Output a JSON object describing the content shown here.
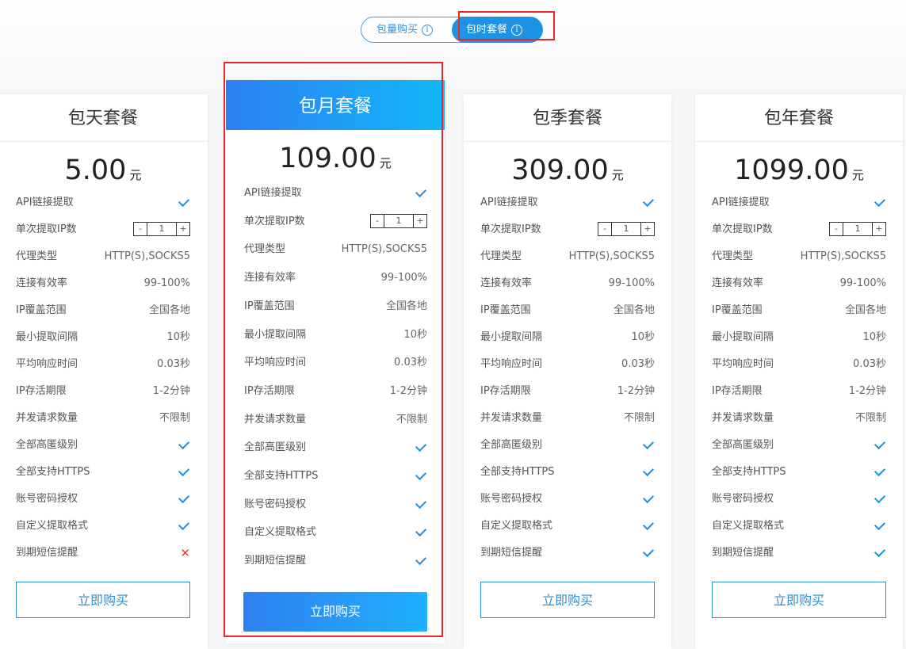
{
  "toggle": {
    "left_label": "包量购买",
    "right_label": "包时套餐",
    "info_glyph": "i"
  },
  "plans": [
    {
      "name": "包天套餐",
      "price": "5.00",
      "unit": "元",
      "features": [
        {
          "label": "API链接提取",
          "type": "check"
        },
        {
          "label": "单次提取IP数",
          "type": "stepper",
          "value": "1"
        },
        {
          "label": "代理类型",
          "type": "text",
          "value": "HTTP(S),SOCKS5"
        },
        {
          "label": "连接有效率",
          "type": "text",
          "value": "99-100%"
        },
        {
          "label": "IP覆盖范围",
          "type": "text",
          "value": "全国各地"
        },
        {
          "label": "最小提取间隔",
          "type": "text",
          "value": "10秒"
        },
        {
          "label": "平均响应时间",
          "type": "text",
          "value": "0.03秒"
        },
        {
          "label": "IP存活期限",
          "type": "text",
          "value": "1-2分钟"
        },
        {
          "label": "并发请求数量",
          "type": "text",
          "value": "不限制"
        },
        {
          "label": "全部高匿级别",
          "type": "check"
        },
        {
          "label": "全部支持HTTPS",
          "type": "check"
        },
        {
          "label": "账号密码授权",
          "type": "check"
        },
        {
          "label": "自定义提取格式",
          "type": "check"
        },
        {
          "label": "到期短信提醒",
          "type": "cross"
        }
      ],
      "button": "立即购买"
    },
    {
      "name": "包月套餐",
      "price": "109.00",
      "unit": "元",
      "features": [
        {
          "label": "API链接提取",
          "type": "check"
        },
        {
          "label": "单次提取IP数",
          "type": "stepper",
          "value": "1"
        },
        {
          "label": "代理类型",
          "type": "text",
          "value": "HTTP(S),SOCKS5"
        },
        {
          "label": "连接有效率",
          "type": "text",
          "value": "99-100%"
        },
        {
          "label": "IP覆盖范围",
          "type": "text",
          "value": "全国各地"
        },
        {
          "label": "最小提取间隔",
          "type": "text",
          "value": "10秒"
        },
        {
          "label": "平均响应时间",
          "type": "text",
          "value": "0.03秒"
        },
        {
          "label": "IP存活期限",
          "type": "text",
          "value": "1-2分钟"
        },
        {
          "label": "并发请求数量",
          "type": "text",
          "value": "不限制"
        },
        {
          "label": "全部高匿级别",
          "type": "check"
        },
        {
          "label": "全部支持HTTPS",
          "type": "check"
        },
        {
          "label": "账号密码授权",
          "type": "check"
        },
        {
          "label": "自定义提取格式",
          "type": "check"
        },
        {
          "label": "到期短信提醒",
          "type": "check"
        }
      ],
      "button": "立即购买"
    },
    {
      "name": "包季套餐",
      "price": "309.00",
      "unit": "元",
      "features": [
        {
          "label": "API链接提取",
          "type": "check"
        },
        {
          "label": "单次提取IP数",
          "type": "stepper",
          "value": "1"
        },
        {
          "label": "代理类型",
          "type": "text",
          "value": "HTTP(S),SOCKS5"
        },
        {
          "label": "连接有效率",
          "type": "text",
          "value": "99-100%"
        },
        {
          "label": "IP覆盖范围",
          "type": "text",
          "value": "全国各地"
        },
        {
          "label": "最小提取间隔",
          "type": "text",
          "value": "10秒"
        },
        {
          "label": "平均响应时间",
          "type": "text",
          "value": "0.03秒"
        },
        {
          "label": "IP存活期限",
          "type": "text",
          "value": "1-2分钟"
        },
        {
          "label": "并发请求数量",
          "type": "text",
          "value": "不限制"
        },
        {
          "label": "全部高匿级别",
          "type": "check"
        },
        {
          "label": "全部支持HTTPS",
          "type": "check"
        },
        {
          "label": "账号密码授权",
          "type": "check"
        },
        {
          "label": "自定义提取格式",
          "type": "check"
        },
        {
          "label": "到期短信提醒",
          "type": "check"
        }
      ],
      "button": "立即购买"
    },
    {
      "name": "包年套餐",
      "price": "1099.00",
      "unit": "元",
      "features": [
        {
          "label": "API链接提取",
          "type": "check"
        },
        {
          "label": "单次提取IP数",
          "type": "stepper",
          "value": "1"
        },
        {
          "label": "代理类型",
          "type": "text",
          "value": "HTTP(S),SOCKS5"
        },
        {
          "label": "连接有效率",
          "type": "text",
          "value": "99-100%"
        },
        {
          "label": "IP覆盖范围",
          "type": "text",
          "value": "全国各地"
        },
        {
          "label": "最小提取间隔",
          "type": "text",
          "value": "10秒"
        },
        {
          "label": "平均响应时间",
          "type": "text",
          "value": "0.03秒"
        },
        {
          "label": "IP存活期限",
          "type": "text",
          "value": "1-2分钟"
        },
        {
          "label": "并发请求数量",
          "type": "text",
          "value": "不限制"
        },
        {
          "label": "全部高匿级别",
          "type": "check"
        },
        {
          "label": "全部支持HTTPS",
          "type": "check"
        },
        {
          "label": "账号密码授权",
          "type": "check"
        },
        {
          "label": "自定义提取格式",
          "type": "check"
        },
        {
          "label": "到期短信提醒",
          "type": "check"
        }
      ],
      "button": "立即购买"
    }
  ],
  "stepper": {
    "dec": "-",
    "inc": "+"
  },
  "colors": {
    "accent": "#2a8fd6",
    "highlight": "#e8262b",
    "cross": "#e53935"
  }
}
